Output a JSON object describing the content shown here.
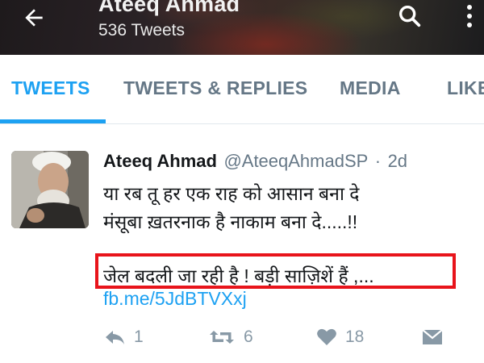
{
  "header": {
    "profile_name": "Ateeq Ahmad",
    "tweet_count": "536 Tweets"
  },
  "tabs": [
    {
      "label": "TWEETS",
      "active": true
    },
    {
      "label": "TWEETS & REPLIES",
      "active": false
    },
    {
      "label": "MEDIA",
      "active": false
    },
    {
      "label": "LIKES",
      "active": false
    }
  ],
  "tweet": {
    "author_name": "Ateeq Ahmad",
    "author_handle": "@AteeqAhmadSP",
    "separator": "·",
    "time": "2d",
    "lines": [
      "या रब तू हर एक राह को आसान बना दे",
      "मंसूबा ख़तरनाक है नाकाम बना दे.....!!",
      "जेल बदली जा रही है ! बड़ी साज़िशें हैं ,..."
    ],
    "link": "fb.me/5JdBTVXxj",
    "actions": {
      "reply_count": "1",
      "retweet_count": "6",
      "like_count": "18"
    }
  },
  "colors": {
    "accent": "#1da1f2",
    "highlight": "#e8141b",
    "muted": "#657786"
  }
}
